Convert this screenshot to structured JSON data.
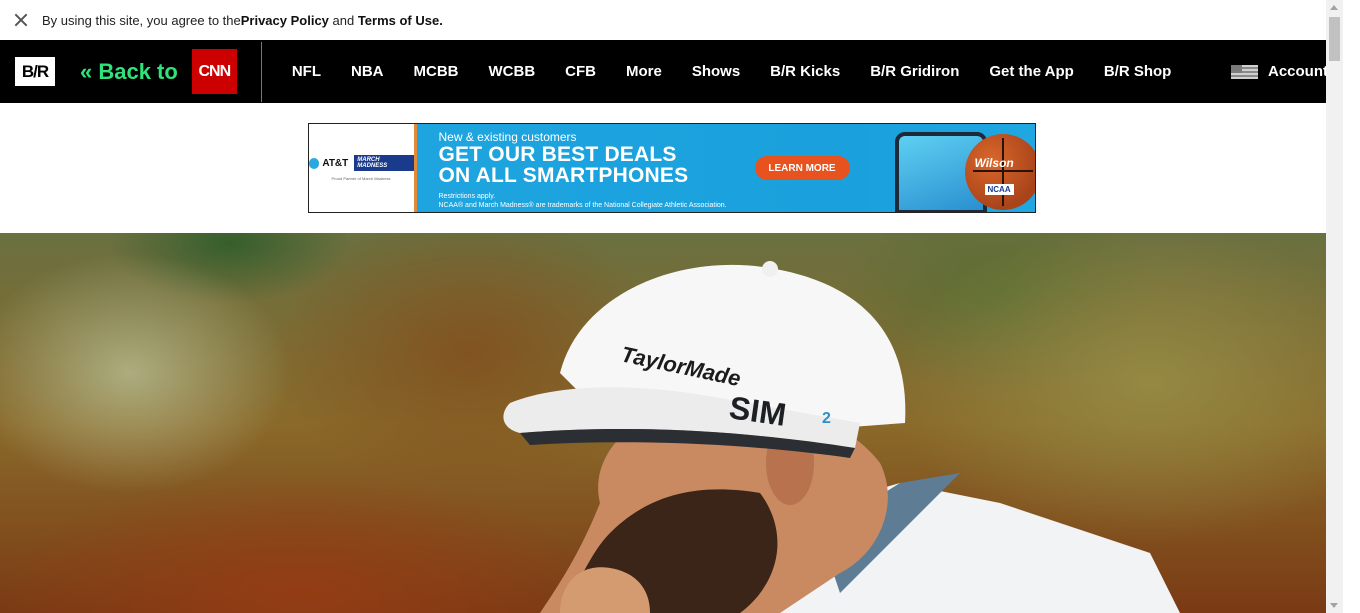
{
  "notice": {
    "prefix": "By using this site, you agree to the ",
    "privacy_link": "Privacy Policy",
    "and": " and ",
    "terms_link": "Terms of Use."
  },
  "nav": {
    "logo": "B/R",
    "back_label": "« Back to",
    "cnn_logo": "CNN",
    "links": [
      "NFL",
      "NBA",
      "MCBB",
      "WCBB",
      "CFB",
      "More",
      "Shows",
      "B/R Kicks",
      "B/R Gridiron",
      "Get the App",
      "B/R Shop"
    ],
    "account": "Account"
  },
  "ad": {
    "brand": "AT&T",
    "partner_badge": "MARCH MADNESS",
    "partner_note": "Proud Partner of March Madness",
    "subhead": "New & existing customers",
    "headline_1": "GET OUR BEST DEALS",
    "headline_2": "ON ALL SMARTPHONES",
    "fine_1": "Restrictions apply.",
    "fine_2": "NCAA® and March Madness® are trademarks of the National Collegiate Athletic Association.",
    "cta": "LEARN MORE",
    "ball_brand": "Wilson",
    "ball_badge": "NCAA"
  },
  "hero": {
    "cap_logo_1": "TaylorMade",
    "cap_logo_2": "SIM2"
  }
}
